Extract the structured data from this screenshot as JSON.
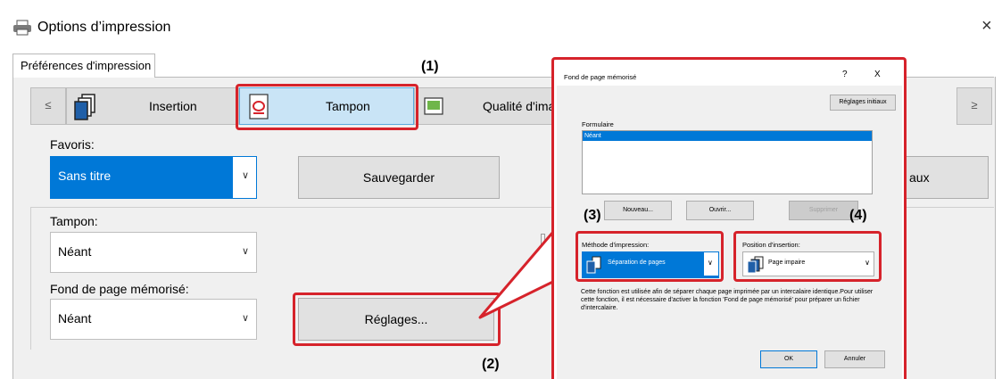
{
  "window": {
    "title": "Options d’impression",
    "close_glyph": "×",
    "tab": "Préférences d'impression"
  },
  "nav": {
    "prev_label": "≤",
    "next_label": "≥",
    "buttons": [
      {
        "label": "Insertion",
        "icon": "insertion-icon"
      },
      {
        "label": "Tampon",
        "icon": "stamp-icon",
        "selected": true
      },
      {
        "label": "Qualité d'ima",
        "icon": "quality-icon"
      }
    ]
  },
  "favoris": {
    "label": "Favoris:",
    "value": "Sans titre",
    "save_label": "Sauvegarder",
    "default_label": "aux"
  },
  "tampon": {
    "label": "Tampon:",
    "value": "Néant"
  },
  "fond": {
    "label": "Fond de page mémorisé:",
    "value": "Néant"
  },
  "reglages_label": "Réglages...",
  "callouts": {
    "c1": "(1)",
    "c2": "(2)",
    "c3": "(3)",
    "c4": "(4)"
  },
  "dialog": {
    "title": "Fond de page mémorisé",
    "help": "?",
    "close": "X",
    "init_button": "Réglages initiaux",
    "list_label": "Formulaire",
    "list_items": [
      "Néant"
    ],
    "new_button": "Nouveau...",
    "open_button": "Ouvrir...",
    "delete_button": "Supprimer",
    "method_label": "Méthode d'impression:",
    "method_value": "Séparation de pages",
    "position_label": "Position d'insertion:",
    "position_value": "Page impaire",
    "description": "Cette fonction est utilisée afin de séparer chaque page imprimée par un intercalaire identique.Pour utiliser cette fonction, il est nécessaire d'activer la fonction 'Fond de page mémorisé' pour préparer un fichier d'intercalaire.",
    "ok": "OK",
    "cancel": "Annuler"
  },
  "colors": {
    "accent": "#0078d7",
    "callout": "#d6232b",
    "selected_tab": "#c9e4f6"
  }
}
